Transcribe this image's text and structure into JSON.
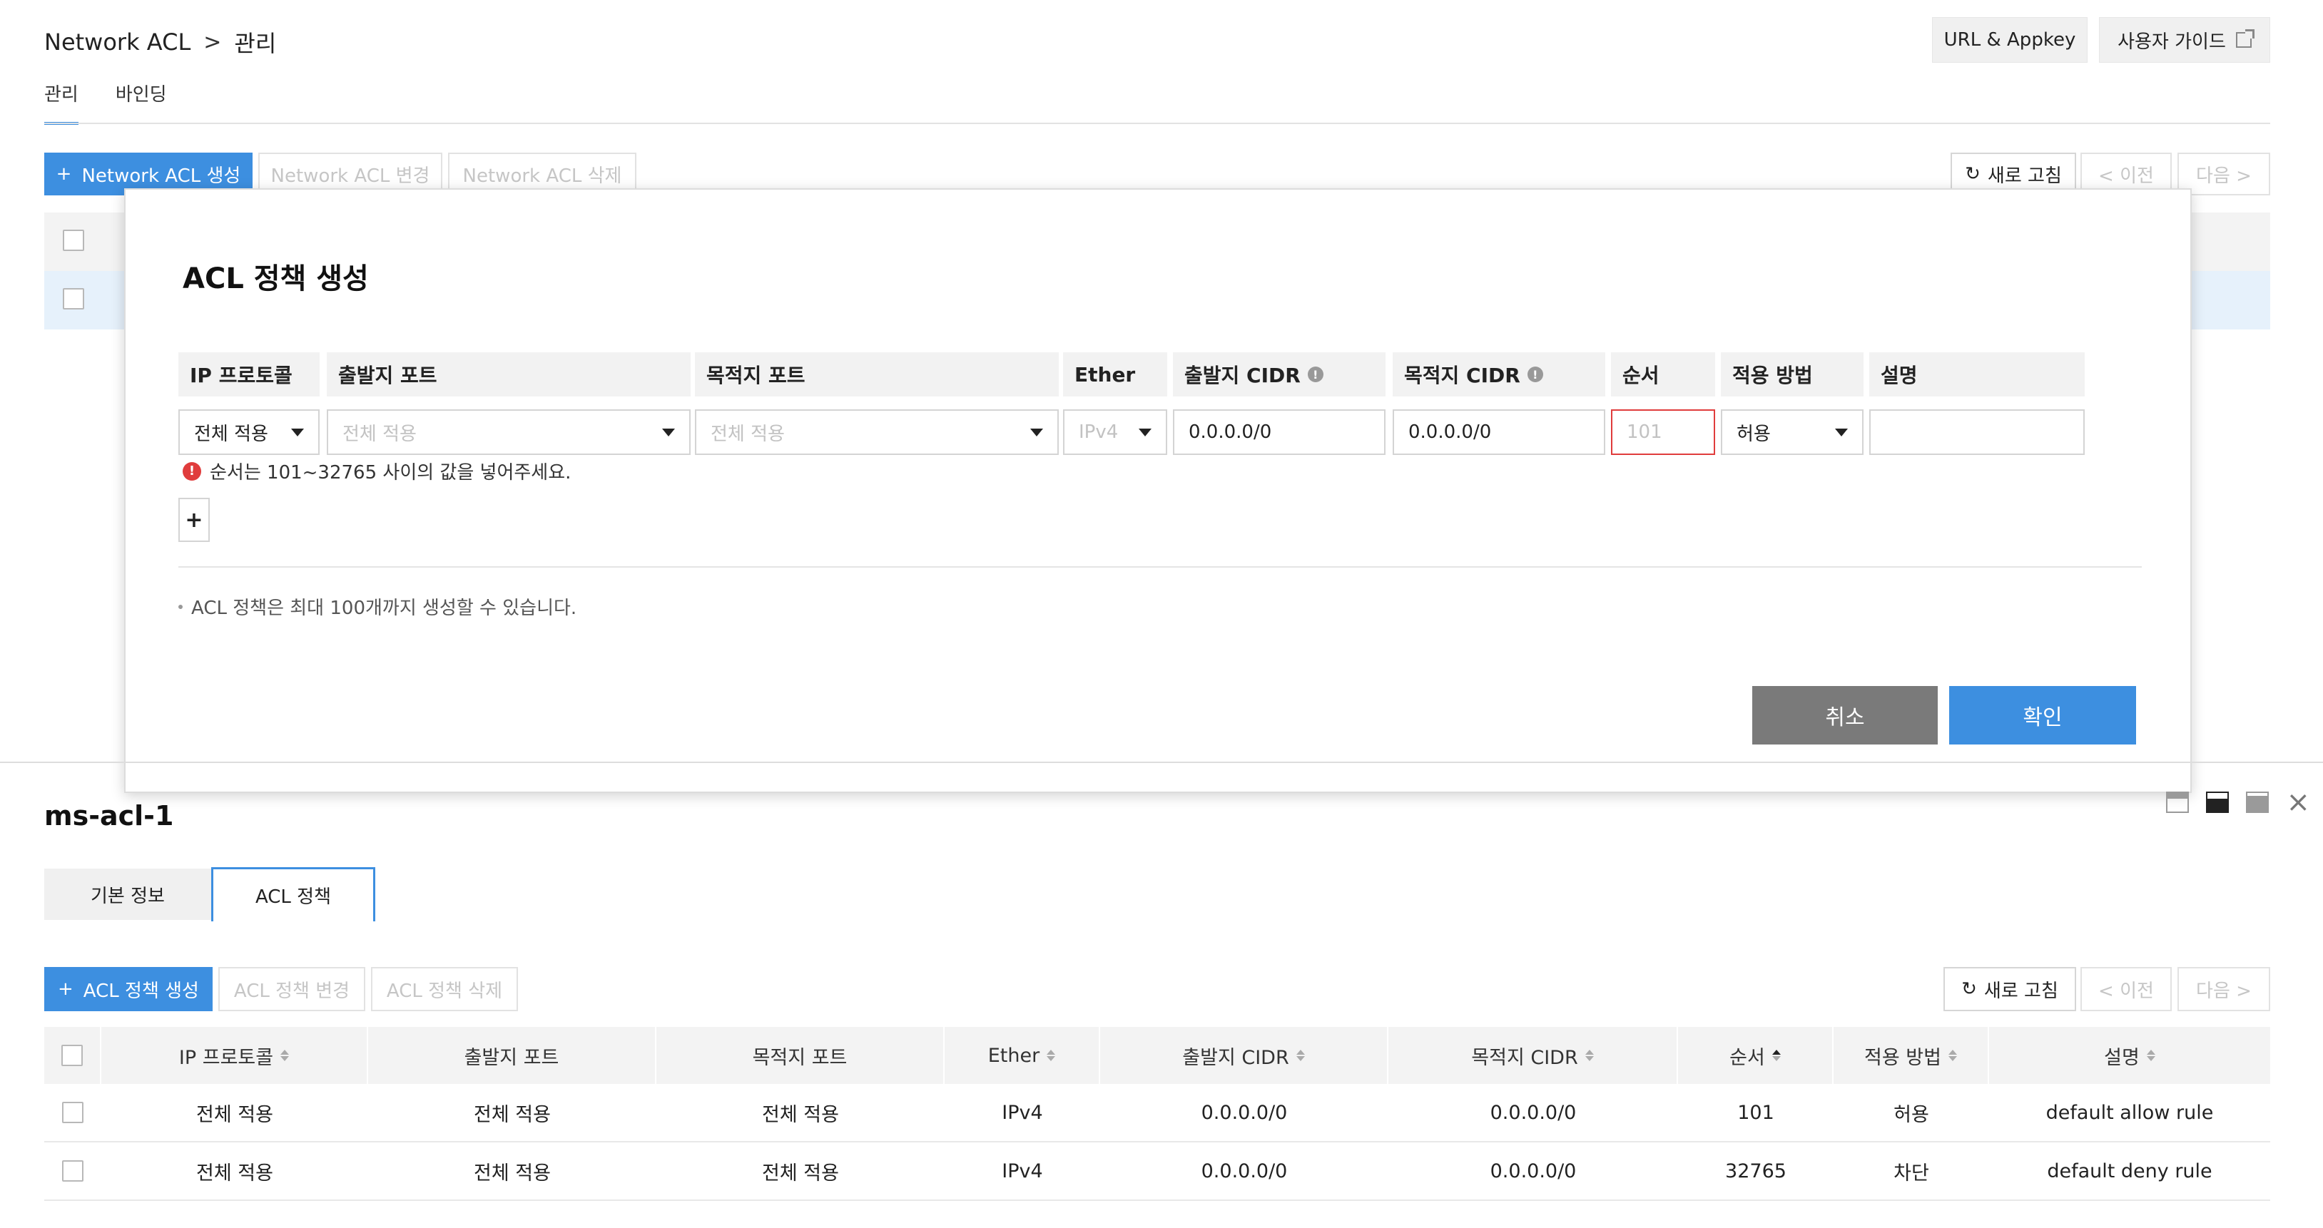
{
  "header": {
    "breadcrumb_root": "Network ACL",
    "breadcrumb_sep": ">",
    "breadcrumb_current": "관리",
    "url_appkey": "URL & Appkey",
    "user_guide": "사용자 가이드"
  },
  "top_tabs": [
    {
      "label": "관리",
      "active": true
    },
    {
      "label": "바인딩",
      "active": false
    }
  ],
  "toolbar": {
    "create": "Network ACL 생성",
    "modify": "Network ACL 변경",
    "delete": "Network ACL 삭제",
    "refresh": "새로 고침",
    "prev": "< 이전",
    "next": "다음 >"
  },
  "modal": {
    "title": "ACL 정책 생성",
    "columns": [
      "IP 프로토콜",
      "출발지 포트",
      "목적지 포트",
      "Ether",
      "출발지 CIDR",
      "목적지 CIDR",
      "순서",
      "적용 방법",
      "설명"
    ],
    "row": {
      "protocol": "전체 적용",
      "src_port_placeholder": "전체 적용",
      "dst_port_placeholder": "전체 적용",
      "ether_placeholder": "IPv4",
      "src_cidr": "0.0.0.0/0",
      "dst_cidr": "0.0.0.0/0",
      "order_placeholder": "101",
      "method": "허용",
      "description": ""
    },
    "error": "순서는 101~32765 사이의 값을 넣어주세요.",
    "add": "+",
    "note": "ACL 정책은 최대 100개까지 생성할 수 있습니다.",
    "cancel": "취소",
    "confirm": "확인"
  },
  "detail": {
    "title": "ms-acl-1",
    "tabs": [
      {
        "label": "기본 정보",
        "active": false
      },
      {
        "label": "ACL 정책",
        "active": true
      }
    ],
    "toolbar": {
      "create": "ACL 정책 생성",
      "modify": "ACL 정책 변경",
      "delete": "ACL 정책 삭제",
      "refresh": "새로 고침",
      "prev": "< 이전",
      "next": "다음 >"
    },
    "table": {
      "headers": [
        "IP 프로토콜",
        "출발지 포트",
        "목적지 포트",
        "Ether",
        "출발지 CIDR",
        "목적지 CIDR",
        "순서",
        "적용 방법",
        "설명"
      ],
      "rows": [
        [
          "전체 적용",
          "전체 적용",
          "전체 적용",
          "IPv4",
          "0.0.0.0/0",
          "0.0.0.0/0",
          "101",
          "허용",
          "default allow rule"
        ],
        [
          "전체 적용",
          "전체 적용",
          "전체 적용",
          "IPv4",
          "0.0.0.0/0",
          "0.0.0.0/0",
          "32765",
          "차단",
          "default deny rule"
        ]
      ]
    }
  },
  "colors": {
    "accent": "#3d8fe0",
    "error": "#e03c3c",
    "cancel": "#7a7a7a",
    "selected_row": "#e6f1fb"
  }
}
